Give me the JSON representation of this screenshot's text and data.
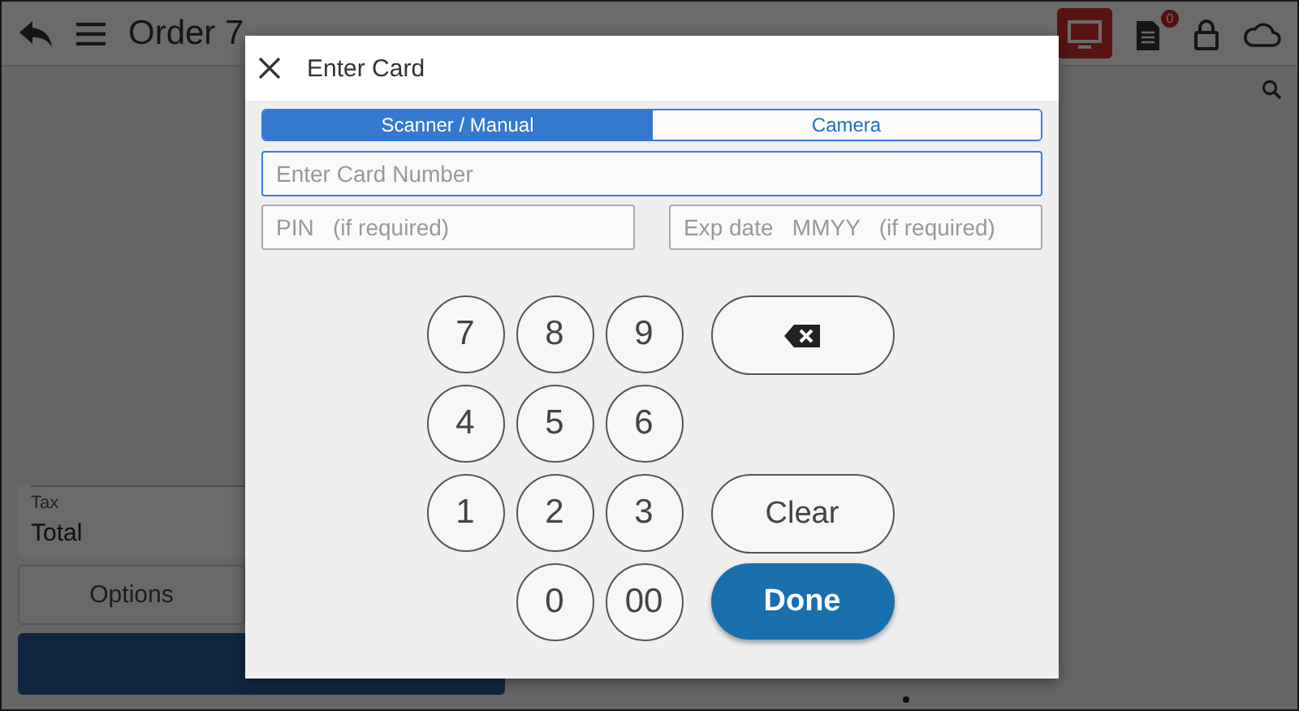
{
  "app_bar": {
    "title": "Order 7",
    "notification_count": "0"
  },
  "summary": {
    "tax_label": "Tax",
    "total_label": "Total"
  },
  "buttons": [
    {
      "kind": "secondary",
      "label": "Options"
    },
    {
      "kind": "primary"
    }
  ],
  "dialog": {
    "title": "Enter Card",
    "tabs": [
      {
        "label": "Scanner / Manual",
        "selected": true
      },
      {
        "label": "Camera",
        "selected": false
      }
    ],
    "fields": [
      {
        "placeholder": "Enter Card Number",
        "focused": true
      },
      {
        "placeholder": "PIN   (if required)",
        "focused": false
      },
      {
        "placeholder": "Exp date   MMYY   (if required)",
        "focused": false
      }
    ],
    "digit_keys": [
      "7",
      "8",
      "9",
      "4",
      "5",
      "6",
      "1",
      "2",
      "3",
      "0",
      "00"
    ],
    "action_keys": [
      {
        "kind": "backspace"
      },
      {
        "kind": "clear",
        "label": "Clear"
      },
      {
        "kind": "done",
        "label": "Done"
      }
    ]
  }
}
